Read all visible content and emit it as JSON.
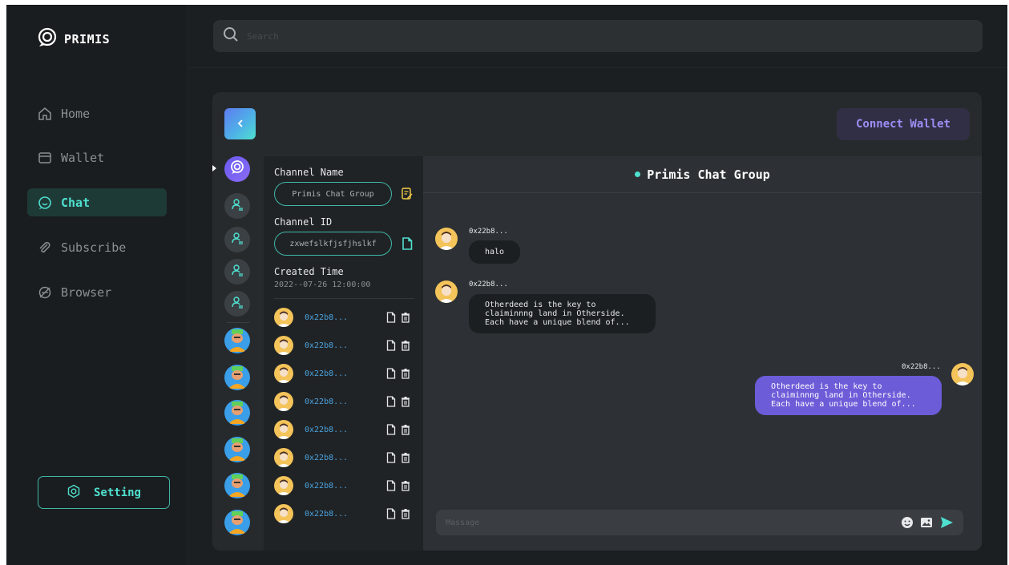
{
  "app": {
    "logo_text": "PRIMIS"
  },
  "sidebar": {
    "items": [
      {
        "label": "Home",
        "icon": "home-icon"
      },
      {
        "label": "Wallet",
        "icon": "wallet-icon"
      },
      {
        "label": "Chat",
        "icon": "chat-icon",
        "active": true
      },
      {
        "label": "Subscribe",
        "icon": "paperclip-icon"
      },
      {
        "label": "Browser",
        "icon": "compass-icon"
      }
    ],
    "setting_label": "Setting"
  },
  "search": {
    "placeholder": "Search"
  },
  "header": {
    "connect_wallet_label": "Connect Wallet"
  },
  "channel": {
    "name_label": "Channel Name",
    "name_value": "Primis Chat Group",
    "id_label": "Channel ID",
    "id_value": "zxwefslkfjsfjhslkf",
    "created_label": "Created Time",
    "created_value": "2022--07-26 12:00:00"
  },
  "members": [
    {
      "address": "0x22b8..."
    },
    {
      "address": "0x22b8..."
    },
    {
      "address": "0x22b8..."
    },
    {
      "address": "0x22b8..."
    },
    {
      "address": "0x22b8..."
    },
    {
      "address": "0x22b8..."
    },
    {
      "address": "0x22b8..."
    },
    {
      "address": "0x22b8..."
    }
  ],
  "chat": {
    "title": "Primis Chat Group",
    "messages": [
      {
        "sender": "0x22b8...",
        "lines": [
          "halo"
        ],
        "mine": false
      },
      {
        "sender": "0x22b8...",
        "lines": [
          "Otherdeed is the key to",
          "claiminnng land in Otherside.",
          "Each have a unique blend of..."
        ],
        "mine": false
      },
      {
        "sender": "0x22b8...",
        "lines": [
          "Otherdeed is the key to",
          "claiminnng land in Otherside.",
          "Each have a unique blend of..."
        ],
        "mine": true
      }
    ],
    "input_placeholder": "Massage"
  },
  "colors": {
    "accent": "#4fe0cf",
    "brand_purple": "#6c5cd8",
    "connect_text": "#9d8ef5",
    "address_blue": "#4aa3e0",
    "background": "#1c1f21"
  }
}
